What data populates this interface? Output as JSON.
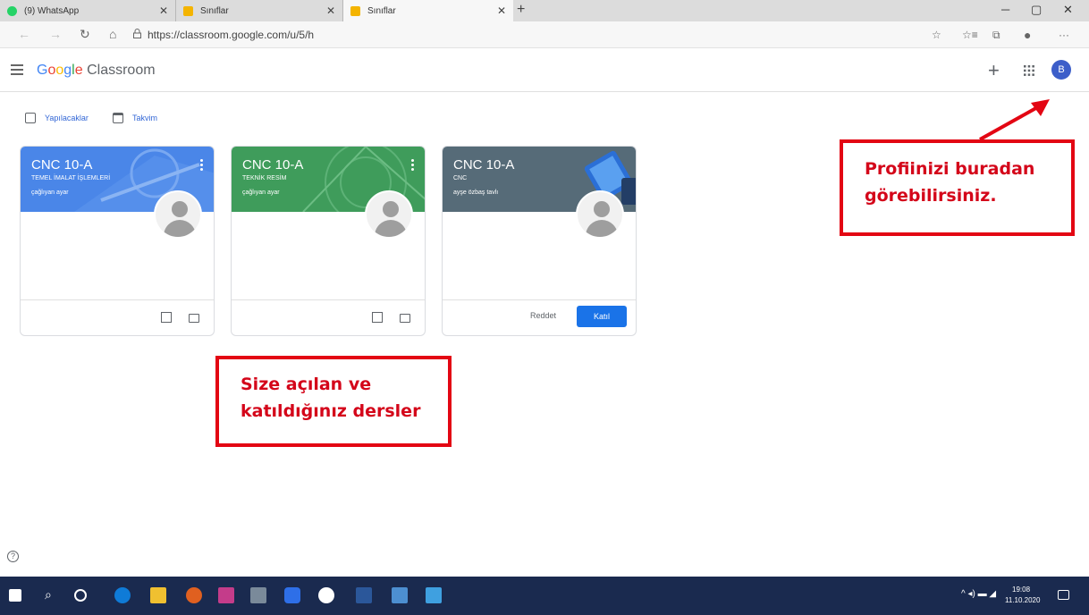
{
  "browser": {
    "tabs": [
      {
        "title": "(9) WhatsApp",
        "favicon_color": "#25d366"
      },
      {
        "title": "Sınıflar",
        "favicon_color": "#f4b400"
      },
      {
        "title": "Sınıflar",
        "favicon_color": "#f4b400"
      }
    ],
    "url": "https://classroom.google.com/u/5/h"
  },
  "app": {
    "logo_google": [
      "G",
      "o",
      "o",
      "g",
      "l",
      "e"
    ],
    "logo_product": "Classroom",
    "avatar_letter": "B",
    "subnav": {
      "todo": "Yapılacaklar",
      "calendar": "Takvim"
    }
  },
  "courses": [
    {
      "title": "CNC 10-A",
      "section": "TEMEL İMALAT İŞLEMLERİ",
      "teacher": "çağlıyan ayar",
      "color": "#4a86e8"
    },
    {
      "title": "CNC 10-A",
      "section": "TEKNİK RESİM",
      "teacher": "çağlıyan ayar",
      "color": "#3f9c5b"
    },
    {
      "title": "CNC 10-A",
      "section": "CNC",
      "teacher": "ayşe özbaş tavlı",
      "color": "#566b78",
      "decline_label": "Reddet",
      "join_label": "Katıl"
    }
  ],
  "annotations": {
    "profile_note_line1": "Profiinizi buradan",
    "profile_note_line2": "görebilirsiniz.",
    "courses_note_line1": "Size açılan ve",
    "courses_note_line2": "katıldığınız dersler"
  },
  "taskbar": {
    "time": "19:08",
    "date": "11.10.2020"
  },
  "accent_color": "#e30613"
}
